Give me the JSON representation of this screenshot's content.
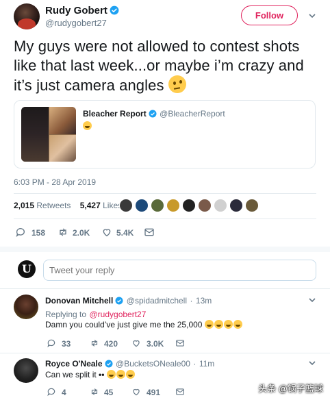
{
  "author": {
    "name": "Rudy Gobert",
    "handle": "@rudygobert27",
    "follow_label": "Follow"
  },
  "tweet": {
    "text": "My guys were not allowed to contest shots like that last week...or maybe i’m crazy and it’s just camera angles",
    "timestamp": "6:03 PM - 28 Apr 2019"
  },
  "quoted": {
    "name": "Bleacher Report",
    "handle": "@BleacherReport"
  },
  "stats": {
    "retweets_count": "2,015",
    "retweets_label": "Retweets",
    "likes_count": "5,427",
    "likes_label": "Likes"
  },
  "actions": {
    "replies": "158",
    "retweets": "2.0K",
    "likes": "5.4K"
  },
  "compose": {
    "placeholder": "Tweet your reply",
    "avatar_letter": "U"
  },
  "replies": [
    {
      "name": "Donovan Mitchell",
      "handle": "@spidadmitchell",
      "sep": "·",
      "time": "13m",
      "replying_prefix": "Replying to",
      "replying_to": "@rudygobert27",
      "text": "Damn you could’ve just give me the 25,000",
      "replies": "33",
      "retweets": "420",
      "likes": "3.0K"
    },
    {
      "name": "Royce O'Neale",
      "handle": "@BucketsONeale00",
      "sep": "·",
      "time": "11m",
      "text": "Can we split it",
      "replies": "4",
      "retweets": "45",
      "likes": "491"
    }
  ],
  "watermark": "头条 @锅子篮球",
  "colors": {
    "accent": "#e0245e",
    "verified": "#1da1f2",
    "muted": "#657786"
  }
}
